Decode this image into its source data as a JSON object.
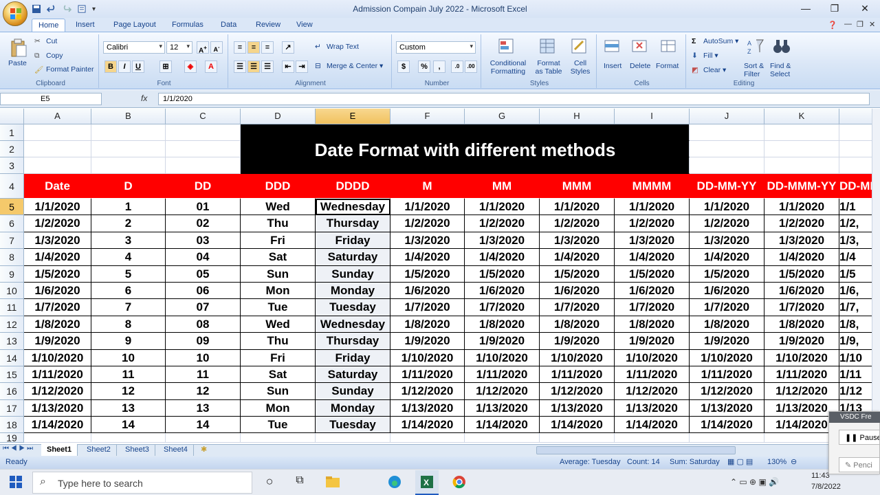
{
  "window": {
    "title": "Admission Compain July 2022 - Microsoft Excel",
    "minimize": "—",
    "restore": "❐",
    "close": "✕"
  },
  "tabs": [
    "Home",
    "Insert",
    "Page Layout",
    "Formulas",
    "Data",
    "Review",
    "View"
  ],
  "ribbon": {
    "clipboard": {
      "label": "Clipboard",
      "paste": "Paste",
      "cut": "Cut",
      "copy": "Copy",
      "format_painter": "Format Painter"
    },
    "font": {
      "label": "Font",
      "name": "Calibri",
      "size": "12",
      "bold": "B",
      "italic": "I",
      "underline": "U"
    },
    "alignment": {
      "label": "Alignment",
      "wrap": "Wrap Text",
      "merge": "Merge & Center"
    },
    "number": {
      "label": "Number",
      "format": "Custom",
      "currency": "$",
      "percent": "%",
      "comma": ","
    },
    "styles": {
      "label": "Styles",
      "conditional": [
        "Conditional",
        "Formatting"
      ],
      "table": [
        "Format",
        "as Table"
      ],
      "cell": [
        "Cell",
        "Styles"
      ]
    },
    "cells": {
      "label": "Cells",
      "insert": "Insert",
      "delete": "Delete",
      "format": "Format"
    },
    "editing": {
      "label": "Editing",
      "autosum": "AutoSum",
      "fill": "Fill",
      "clear": "Clear",
      "sort": [
        "Sort &",
        "Filter"
      ],
      "find": [
        "Find &",
        "Select"
      ]
    }
  },
  "formula_bar": {
    "name_box": "E5",
    "fx": "fx",
    "value": "1/1/2020"
  },
  "columns": [
    "A",
    "B",
    "C",
    "D",
    "E",
    "F",
    "G",
    "H",
    "I",
    "J",
    "K"
  ],
  "selected_column": "E",
  "selected_row": "5",
  "sheet": {
    "banner": "Date Format with different methods",
    "headers": [
      "Date",
      "D",
      "DD",
      "DDD",
      "DDDD",
      "M",
      "MM",
      "MMM",
      "MMMM",
      "DD-MM-YY",
      "DD-MMM-YY",
      "DD-MM"
    ],
    "rows": [
      {
        "n": "5",
        "date": "1/1/2020",
        "d": "1",
        "dd": "01",
        "ddd": "Wed",
        "dddd": "Wednesday",
        "f": "1/1/2020",
        "cut": "1/1"
      },
      {
        "n": "6",
        "date": "1/2/2020",
        "d": "2",
        "dd": "02",
        "ddd": "Thu",
        "dddd": "Thursday",
        "f": "1/2/2020",
        "cut": "1/2,"
      },
      {
        "n": "7",
        "date": "1/3/2020",
        "d": "3",
        "dd": "03",
        "ddd": "Fri",
        "dddd": "Friday",
        "f": "1/3/2020",
        "cut": "1/3,"
      },
      {
        "n": "8",
        "date": "1/4/2020",
        "d": "4",
        "dd": "04",
        "ddd": "Sat",
        "dddd": "Saturday",
        "f": "1/4/2020",
        "cut": "1/4"
      },
      {
        "n": "9",
        "date": "1/5/2020",
        "d": "5",
        "dd": "05",
        "ddd": "Sun",
        "dddd": "Sunday",
        "f": "1/5/2020",
        "cut": "1/5"
      },
      {
        "n": "10",
        "date": "1/6/2020",
        "d": "6",
        "dd": "06",
        "ddd": "Mon",
        "dddd": "Monday",
        "f": "1/6/2020",
        "cut": "1/6,"
      },
      {
        "n": "11",
        "date": "1/7/2020",
        "d": "7",
        "dd": "07",
        "ddd": "Tue",
        "dddd": "Tuesday",
        "f": "1/7/2020",
        "cut": "1/7,"
      },
      {
        "n": "12",
        "date": "1/8/2020",
        "d": "8",
        "dd": "08",
        "ddd": "Wed",
        "dddd": "Wednesday",
        "f": "1/8/2020",
        "cut": "1/8,"
      },
      {
        "n": "13",
        "date": "1/9/2020",
        "d": "9",
        "dd": "09",
        "ddd": "Thu",
        "dddd": "Thursday",
        "f": "1/9/2020",
        "cut": "1/9,"
      },
      {
        "n": "14",
        "date": "1/10/2020",
        "d": "10",
        "dd": "10",
        "ddd": "Fri",
        "dddd": "Friday",
        "f": "1/10/2020",
        "cut": "1/10"
      },
      {
        "n": "15",
        "date": "1/11/2020",
        "d": "11",
        "dd": "11",
        "ddd": "Sat",
        "dddd": "Saturday",
        "f": "1/11/2020",
        "cut": "1/11"
      },
      {
        "n": "16",
        "date": "1/12/2020",
        "d": "12",
        "dd": "12",
        "ddd": "Sun",
        "dddd": "Sunday",
        "f": "1/12/2020",
        "cut": "1/12"
      },
      {
        "n": "17",
        "date": "1/13/2020",
        "d": "13",
        "dd": "13",
        "ddd": "Mon",
        "dddd": "Monday",
        "f": "1/13/2020",
        "cut": "1/13"
      },
      {
        "n": "18",
        "date": "1/14/2020",
        "d": "14",
        "dd": "14",
        "ddd": "Tue",
        "dddd": "Tuesday",
        "f": "1/14/2020",
        "cut": "1/14"
      }
    ]
  },
  "sheets": [
    "Sheet1",
    "Sheet2",
    "Sheet3",
    "Sheet4"
  ],
  "status": {
    "ready": "Ready",
    "average": "Average: Tuesday",
    "count": "Count: 14",
    "sum": "Sum: Saturday",
    "zoom": "130%"
  },
  "taskbar": {
    "search_placeholder": "Type here to search",
    "time": "11:43",
    "date": "7/8/2022"
  },
  "vsdc": {
    "title": "VSDC Fre",
    "pause": "Pause",
    "pencil": "Penci"
  },
  "colors": {
    "header_red": "#ff0000",
    "banner_black": "#000000",
    "selection": "#f5c96b",
    "ribbon_blue": "#dbe7f7"
  }
}
